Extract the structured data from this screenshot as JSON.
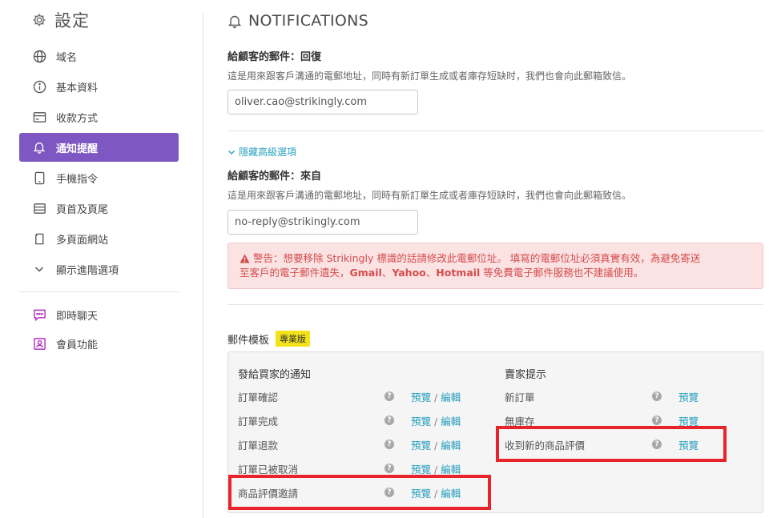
{
  "sidebar": {
    "title": "設定",
    "items": [
      {
        "label": "域名",
        "icon": "globe-icon"
      },
      {
        "label": "基本資料",
        "icon": "info-icon"
      },
      {
        "label": "收款方式",
        "icon": "card-icon"
      },
      {
        "label": "通知提醒",
        "icon": "bell-icon",
        "active": true
      },
      {
        "label": "手機指令",
        "icon": "tablet-icon"
      },
      {
        "label": "頁首及頁尾",
        "icon": "layout-icon"
      },
      {
        "label": "多頁面網站",
        "icon": "pages-icon"
      },
      {
        "label": "顯示進階選項",
        "icon": "chevron-down-icon"
      }
    ],
    "extra_items": [
      {
        "label": "即時聊天",
        "icon": "chat-icon"
      },
      {
        "label": "會員功能",
        "icon": "member-icon"
      }
    ]
  },
  "main": {
    "title": "NOTIFICATIONS",
    "reply_to": {
      "label": "給顧客的郵件：回復",
      "description": "這是用來跟客戶溝通的電郵地址，同時有新訂單生成或者庫存短缺时，我們也會向此郵箱致信。",
      "value": "oliver.cao@strikingly.com"
    },
    "advanced_link": "隱藏高級選項",
    "from": {
      "label": "給顧客的郵件：來自",
      "description": "這是用來跟客戶溝通的電郵地址，同時有新訂單生成或者庫存短缺时，我們也會向此郵箱致信。",
      "value": "no-reply@strikingly.com"
    },
    "warning": {
      "line1": "警告：想要移除 Strikingly 標識的話請修改此電郵位址。 填寫的電郵位址必須真實有效，為避免寄送",
      "line2_pre": "至客戶的電子郵件遺失，",
      "gmail": "Gmail",
      "sep1": "、",
      "yahoo": "Yahoo",
      "sep2": "、",
      "hotmail": "Hotmail",
      "line2_post": " 等免費電子郵件服務也不建議使用。"
    },
    "templates": {
      "title": "郵件模板",
      "badge": "專業版",
      "buyer": {
        "heading": "發給買家的通知",
        "rows": [
          {
            "name": "訂單確認",
            "preview": "預覽",
            "slash": "/",
            "edit": "編輯"
          },
          {
            "name": "訂單完成",
            "preview": "預覽",
            "slash": "/",
            "edit": "編輯"
          },
          {
            "name": "訂單退款",
            "preview": "預覽",
            "slash": "/",
            "edit": "編輯"
          },
          {
            "name": "訂單已被取消",
            "preview": "預覽",
            "slash": "/",
            "edit": "編輯"
          },
          {
            "name": "商品評價邀請",
            "preview": "預覽",
            "slash": "/",
            "edit": "編輯"
          }
        ]
      },
      "seller": {
        "heading": "賣家提示",
        "rows": [
          {
            "name": "新訂單",
            "preview": "預覽"
          },
          {
            "name": "無庫存",
            "preview": "預覽"
          },
          {
            "name": "收到新的商品評價",
            "preview": "預覽"
          }
        ]
      }
    }
  },
  "colors": {
    "accent": "#7e57c2",
    "link": "#2aa1c0",
    "warning_text": "#d54c4c",
    "highlight": "#e8232a",
    "badge": "#f4e219"
  }
}
